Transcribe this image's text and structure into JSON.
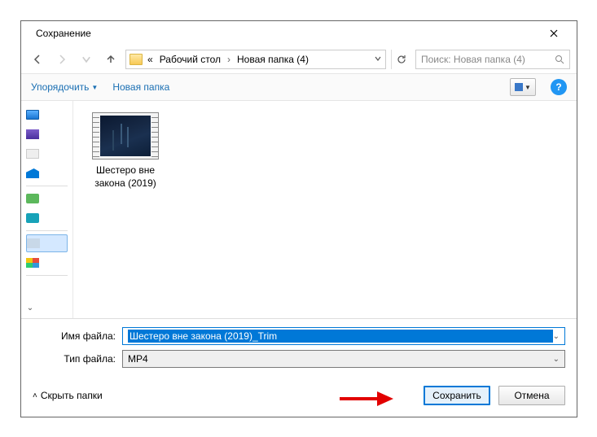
{
  "window": {
    "title": "Сохранение"
  },
  "breadcrumb": {
    "prefix": "«",
    "items": [
      "Рабочий стол",
      "Новая папка (4)"
    ]
  },
  "search": {
    "placeholder": "Поиск: Новая папка (4)"
  },
  "toolbar": {
    "organize": "Упорядочить",
    "new_folder": "Новая папка"
  },
  "files": [
    {
      "name": "Шестеро вне закона (2019)"
    }
  ],
  "fields": {
    "filename_label": "Имя файла:",
    "filename_value": "Шестеро вне закона (2019)_Trim",
    "filetype_label": "Тип файла:",
    "filetype_value": "MP4"
  },
  "footer": {
    "hide_folders": "Скрыть папки",
    "save": "Сохранить",
    "cancel": "Отмена"
  }
}
